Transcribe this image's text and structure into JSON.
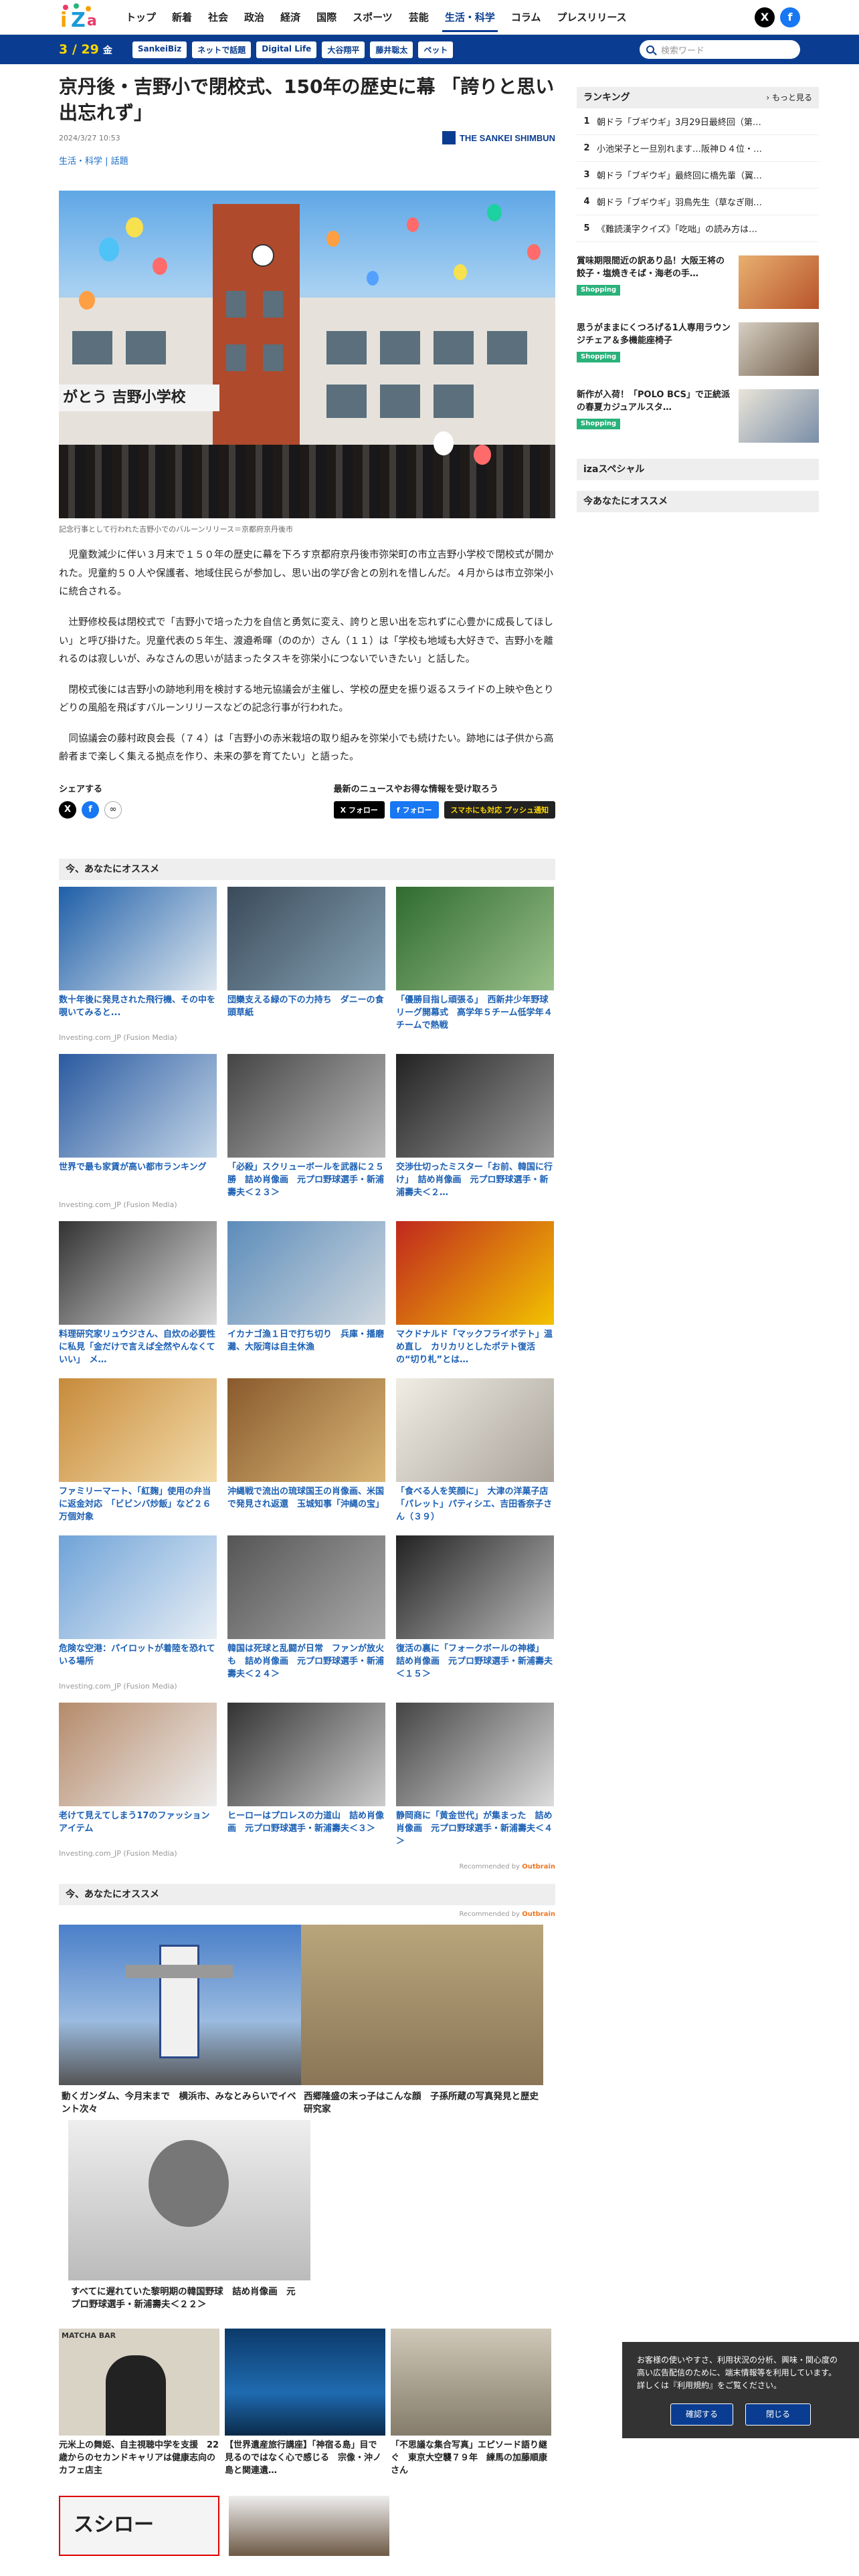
{
  "header": {
    "nav": [
      "トップ",
      "新着",
      "社会",
      "政治",
      "経済",
      "国際",
      "スポーツ",
      "芸能",
      "生活・科学",
      "コラム",
      "プレスリリース"
    ],
    "active_nav": "生活・科学"
  },
  "bluebar": {
    "date": "3 / 29",
    "weekday": "金",
    "tags": [
      "SankeiBiz",
      "ネットで話題",
      "Digital Life",
      "大谷翔平",
      "藤井聡太",
      "ペット"
    ],
    "search_placeholder": "検索ワード"
  },
  "article": {
    "title": "京丹後・吉野小で閉校式、150年の歴史に幕 「誇りと思い出忘れず」",
    "published": "2024/3/27 10:53",
    "brand": "THE SANKEI SHIMBUN",
    "category_main": "生活・科学",
    "category_sub": "話題",
    "sign_text": "がとう 吉野小学校",
    "caption": "記念行事として行われた吉野小でのバルーンリリース＝京都府京丹後市",
    "paragraphs": [
      "児童数減少に伴い３月末で１５０年の歴史に幕を下ろす京都府京丹後市弥栄町の市立吉野小学校で閉校式が開かれた。児童約５０人や保護者、地域住民らが参加し、思い出の学び舎との別れを惜しんだ。４月からは市立弥栄小に統合される。",
      "辻野修校長は閉校式で「吉野小で培った力を自信と勇気に変え、誇りと思い出を忘れずに心豊かに成長してほしい」と呼び掛けた。児童代表の５年生、渡邉希暉（ののか）さん（１１）は「学校も地域も大好きで、吉野小を離れるのは寂しいが、みなさんの思いが詰まったタスキを弥栄小につないでいきたい」と話した。",
      "閉校式後には吉野小の跡地利用を検討する地元協議会が主催し、学校の歴史を振り返るスライドの上映や色とりどりの風船を飛ばすバルーンリリースなどの記念行事が行われた。",
      "同協議会の藤村政良会長（７４）は「吉野小の赤米栽培の取り組みを弥栄小でも続けたい。跡地には子供から高齢者まで楽しく集える拠点を作り、未来の夢を育てたい」と語った。"
    ]
  },
  "share": {
    "label": "シェアする",
    "follow_label": "最新のニュースやお得な情報を受け取ろう",
    "follow_x": "フォロー",
    "follow_fb": "フォロー",
    "push": "スマホにも対応 プッシュ通知"
  },
  "reco1": {
    "heading": "今、あなたにオススメ",
    "items": [
      {
        "title": "数十年後に発見された飛行機、その中を覗いてみると...",
        "source": "Investing.com_JP (Fusion Media)"
      },
      {
        "title": "団欒支える緑の下の力持ち　ダニーの食頭草紙",
        "source": ""
      },
      {
        "title": "「優勝目指し頑張る」　西新井少年野球リーグ開幕式　高学年５チーム低学年４チームで熱戦",
        "source": ""
      },
      {
        "title": "世界で最も家賃が高い都市ランキング",
        "source": "Investing.com_JP (Fusion Media)"
      },
      {
        "title": "「必殺」スクリューボールを武器に２５勝　詰め肖像画　元プロ野球選手・新浦壽夫＜２３＞",
        "source": ""
      },
      {
        "title": "交渉仕切ったミスター「お前、韓国に行け」　詰め肖像画　元プロ野球選手・新浦壽夫＜２…",
        "source": ""
      },
      {
        "title": "料理研究家リュウジさん、自炊の必要性に私見「金だけで言えば全然やんなくていい」　メ…",
        "source": ""
      },
      {
        "title": "イカナゴ漁１日で打ち切り　兵庫・播磨灘、大阪湾は自主休漁",
        "source": ""
      },
      {
        "title": "マクドナルド「マックフライポテト」温め直し　カリカリとしたポテト復活の“切り札”とは…",
        "source": ""
      },
      {
        "title": "ファミリーマート、「紅麹」使用の弁当に返金対応　「ビビンバ炒飯」など２６万個対象",
        "source": ""
      },
      {
        "title": "沖縄戦で流出の琉球国王の肖像画、米国で発見され返還　玉城知事「沖縄の宝」",
        "source": ""
      },
      {
        "title": "「食べる人を笑顔に」　大津の洋菓子店「パレット」パティシエ、吉田香奈子さん（３９）",
        "source": ""
      },
      {
        "title": "危険な空港：パイロットが着陸を恐れている場所",
        "source": "Investing.com_JP (Fusion Media)"
      },
      {
        "title": "韓国は死球と乱闘が日常　ファンが放火も　詰め肖像画　元プロ野球選手・新浦壽夫＜２４＞",
        "source": ""
      },
      {
        "title": "復活の裏に「フォークボールの神様」　詰め肖像画　元プロ野球選手・新浦壽夫＜１５＞",
        "source": ""
      },
      {
        "title": "老けて見えてしまう17のファッションアイテム",
        "source": "Investing.com_JP (Fusion Media)"
      },
      {
        "title": "ヒーローはプロレスの力道山　詰め肖像画　元プロ野球選手・新浦壽夫＜３＞",
        "source": ""
      },
      {
        "title": "静岡商に「黄金世代」が集まった　詰め肖像画　元プロ野球選手・新浦壽夫＜４＞",
        "source": ""
      }
    ],
    "recommended_by": "Recommended by",
    "outbrain": "Outbrain"
  },
  "reco2": {
    "heading": "今、あなたにオススメ",
    "items": [
      {
        "title": "動くガンダム、今月末まで　横浜市、みなとみらいでイベント次々"
      },
      {
        "title": "西郷隆盛の末っ子はこんな顔　子孫所蔵の写真発見と歴史研究家"
      },
      {
        "title": "すべてに遅れていた黎明期の韓国野球　詰め肖像画　元プロ野球選手・新浦壽夫＜２２＞"
      },
      {
        "title": "元米上の舞姫、自主視聴中学を支援　22歳からのセカンドキャリアは健康志向のカフェ店主"
      },
      {
        "title": "【世界遺産旅行講座】「神宿る島」目で見るのではなく心で感じる　宗像・沖ノ島と関連遺…"
      },
      {
        "title": "「不思議な集合写真」エピソード語り継ぐ　東京大空襲７９年　練馬の加藤順康さん"
      }
    ],
    "matcha_sign": "MATCHA BAR",
    "sushiro_sign": "スシロー"
  },
  "sidebar": {
    "ranking_title": "ランキング",
    "more": "もっと見る",
    "ranking": [
      "朝ドラ「ブギウギ」3月29日最終回（第…",
      "小池栄子と一旦別れます…阪神Ｄ４位・…",
      "朝ドラ「ブギウギ」最終回に橋先輩（翼…",
      "朝ドラ「ブギウギ」羽鳥先生（草なぎ剛…",
      "《難読漢字クイズ》「吃咄」の読み方は…"
    ],
    "shopping": [
      {
        "title": "賞味期限間近の訳あり品！大阪王将の餃子・塩焼きそば・海老の手…",
        "label": "Shopping"
      },
      {
        "title": "思うがままにくつろげる1人専用ラウンジチェア＆多機能座椅子",
        "label": "Shopping"
      },
      {
        "title": "新作が入荷！「POLO BCS」で正統派の春夏カジュアルスタ…",
        "label": "Shopping"
      }
    ],
    "special": "izaスペシャル",
    "osusume": "今あなたにオススメ"
  },
  "cookie": {
    "text": "お客様の使いやすさ、利用状況の分析、興味・関心度の高い広告配信のために、端末情報等を利用しています。詳しくは『利用規約』をご覧ください。",
    "confirm": "確認する",
    "close": "閉じる"
  },
  "colors": {
    "brand_blue": "#0a3d91",
    "accent_yellow": "#ffd700",
    "link_blue": "#1a5fb4"
  }
}
